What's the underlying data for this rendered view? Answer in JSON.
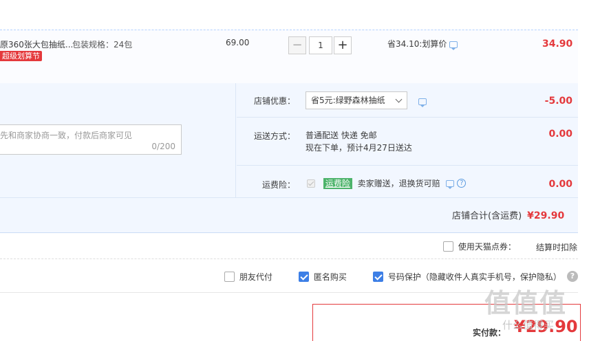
{
  "item": {
    "name": "原360张大包抽纸...",
    "spec": "包装规格：24包",
    "promo_badge": "超级划算节",
    "price": "69.00",
    "quantity": "1",
    "qty_minus": "−",
    "qty_plus": "+",
    "saving": "省34.10:划算价",
    "total": "34.90"
  },
  "shop": {
    "message_placeholder": "先和商家协商一致，付款后商家可见",
    "message_count": "0/200",
    "discount_label": "店铺优惠：",
    "discount_selected": "省5元:绿野森林抽纸",
    "discount_amount": "-5.00",
    "shipping_label": "运送方式：",
    "shipping_line1": "普通配送 快递 免邮",
    "shipping_line2": "现在下单，预计4月27日送达",
    "shipping_amount": "0.00",
    "insurance_label": "运费险：",
    "insurance_badge": "运费险",
    "insurance_text": "卖家赠送，退换货可赔",
    "insurance_amount": "0.00",
    "total_label": "店铺合计(含运费)",
    "total_value": "¥29.90"
  },
  "coupon": {
    "label": "使用天猫点券：",
    "note": "结算时扣除"
  },
  "options": {
    "friend_pay": "朋友代付",
    "anonymous": "匿名购买",
    "number_protect": "号码保护（隐藏收件人真实手机号，保护隐私）",
    "help": "?"
  },
  "payment": {
    "label": "实付款：",
    "value": "¥29.90"
  },
  "watermark": {
    "logo": "值值值",
    "url": "什么值得买"
  },
  "colors": {
    "accent": "#e4393c",
    "checkbox": "#3d7fe6",
    "block_bg": "#f2f7ff"
  }
}
